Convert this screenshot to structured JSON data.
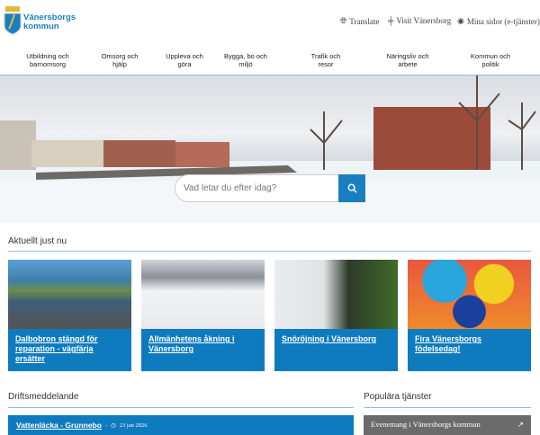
{
  "brand": {
    "name_line1": "Vänersborgs",
    "name_line2": "kommun"
  },
  "utility": {
    "translate": "Translate",
    "visit": "Visit Vänersborg",
    "mina": "Mina sidor (e-tjänster)"
  },
  "nav": [
    [
      "Utbildning och",
      "barnomsorg"
    ],
    [
      "Omsorg och",
      "hjälp"
    ],
    [
      "Uppleva och",
      "göra"
    ],
    [
      "Bygga, bo och",
      "miljö"
    ],
    [
      "Trafik och",
      "resor"
    ],
    [
      "Näringsliv och",
      "arbete"
    ],
    [
      "Kommun och",
      "politik"
    ]
  ],
  "search": {
    "placeholder": "Vad letar du efter idag?"
  },
  "news": {
    "heading": "Aktuellt just nu",
    "items": [
      {
        "title": "Dalbobron stängd för reparation - vägfärja ersätter"
      },
      {
        "title": "Allmänhetens åkning i Vänersborg"
      },
      {
        "title": "Snöröjning i Vänersborg"
      },
      {
        "title": "Fira Vänersborgs födelsedag!"
      }
    ]
  },
  "drift": {
    "heading": "Driftsmeddelande",
    "item_title": "Vattenläcka - Grunnebo",
    "separator": "-",
    "item_date": "23 jan 2026"
  },
  "popular": {
    "heading": "Populära tjänster",
    "item": "Evenemang i Vänersborgs kommun"
  },
  "colors": {
    "accent": "#0f7bbf",
    "line": "#8dbfd9"
  }
}
